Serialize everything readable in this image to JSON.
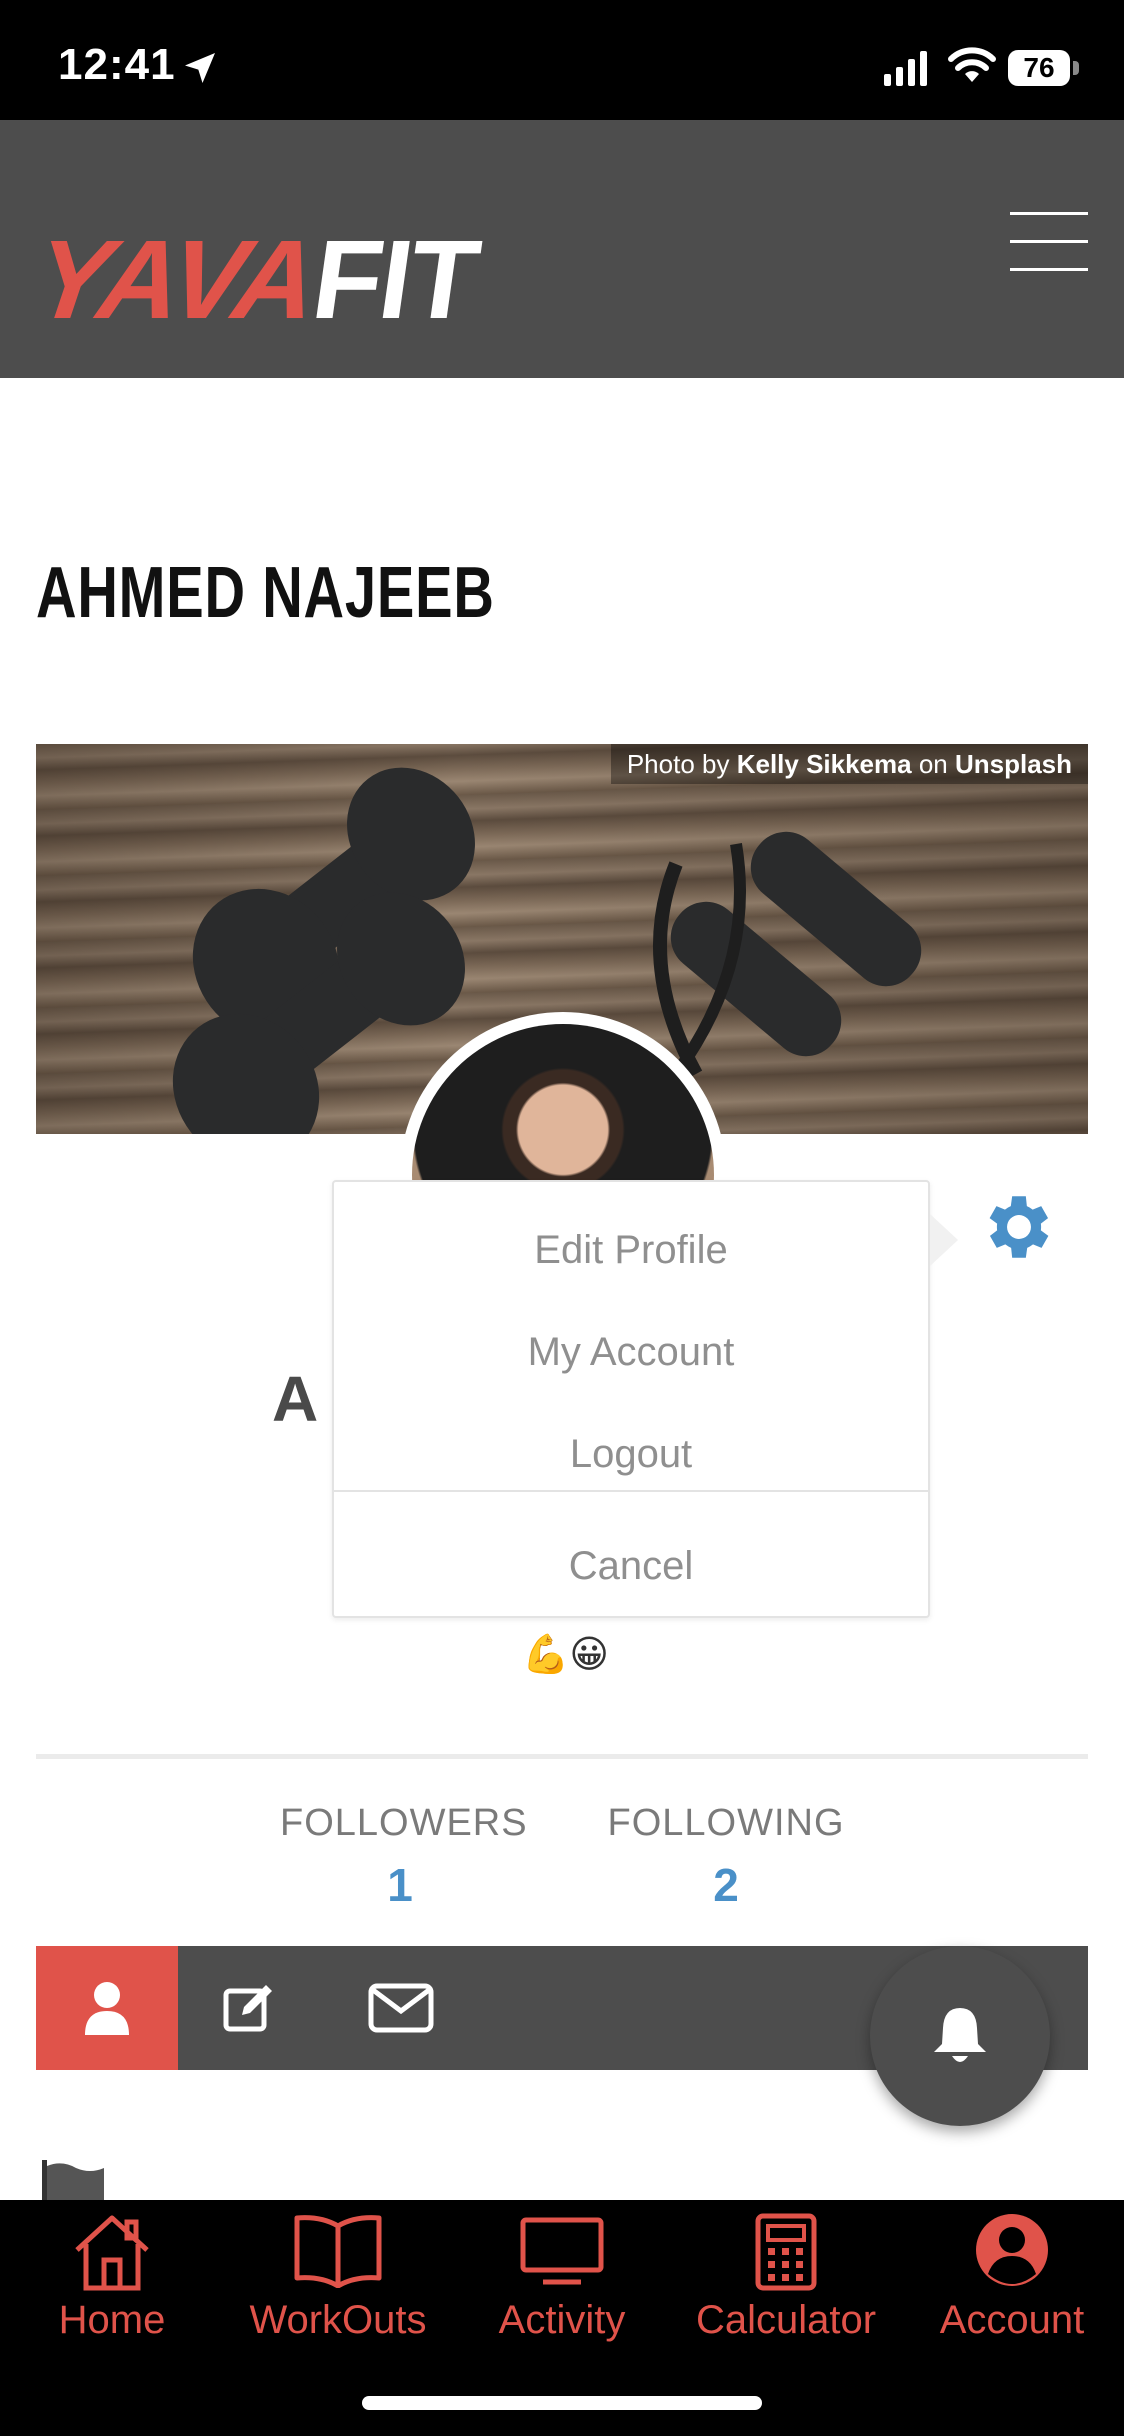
{
  "status_bar": {
    "time": "12:41",
    "battery": "76"
  },
  "header": {
    "logo_part1": "YAVA",
    "logo_part2": "FIT"
  },
  "profile": {
    "name": "AHMED NAJEEB",
    "name_partial": "A",
    "emoji": "💪😀"
  },
  "cover": {
    "credit_prefix": "Photo by ",
    "credit_author": "Kelly Sikkema",
    "credit_mid": " on ",
    "credit_site": "Unsplash"
  },
  "popup": {
    "items": [
      "Edit Profile",
      "My Account",
      "Logout"
    ],
    "cancel": "Cancel"
  },
  "stats": {
    "followers_label": "FOLLOWERS",
    "followers_value": "1",
    "following_label": "FOLLOWING",
    "following_value": "2"
  },
  "tabs": [
    "user-icon",
    "edit-icon",
    "mail-icon"
  ],
  "bottom_nav": {
    "items": [
      "Home",
      "WorkOuts",
      "Activity",
      "Calculator",
      "Account"
    ]
  },
  "colors": {
    "accent": "#e0534a",
    "header_bg": "#4d4d4d",
    "stat_blue": "#4a90c8"
  }
}
